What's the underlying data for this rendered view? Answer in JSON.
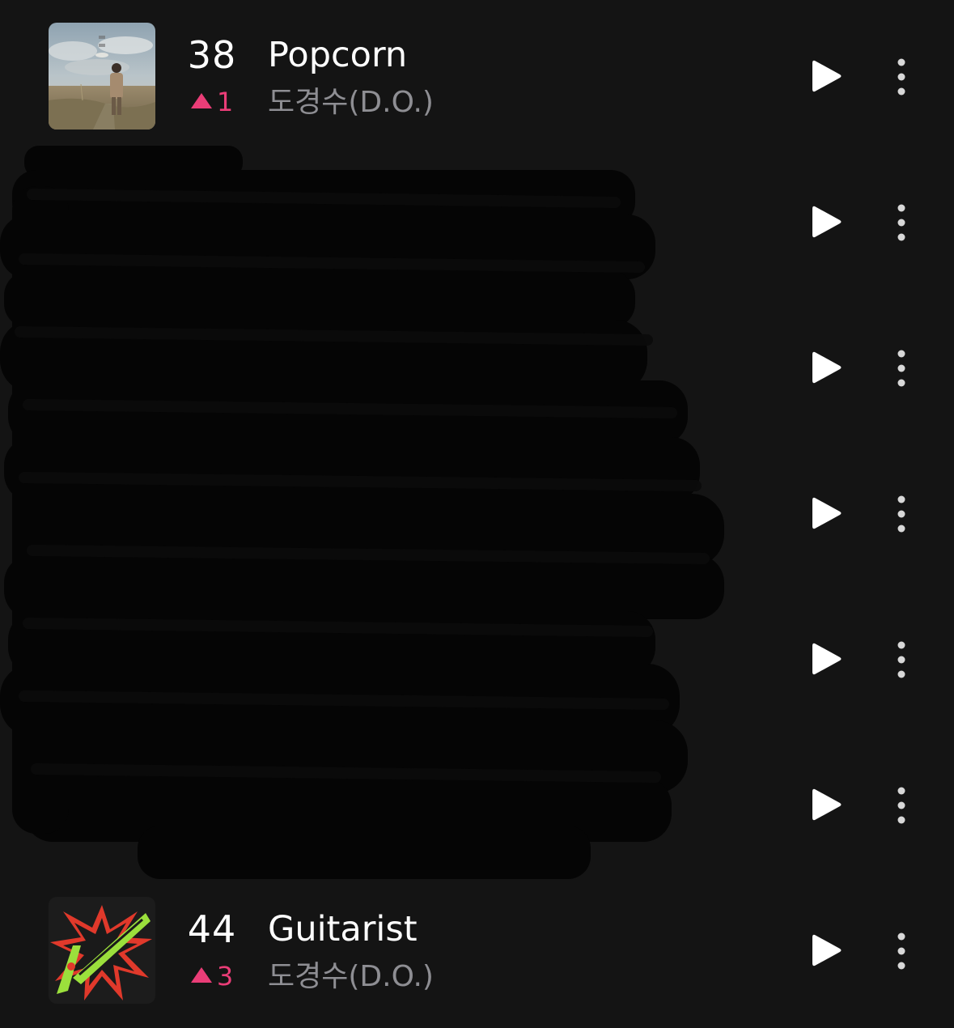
{
  "chart_list": {
    "rows": [
      {
        "rank": "38",
        "change": "1",
        "change_direction": "up",
        "title": "Popcorn",
        "artist": "도경수(D.O.)",
        "cover_icon": "album-cover-popcorn",
        "visible": true
      },
      {
        "rank": "",
        "title": "",
        "artist": "",
        "visible": false,
        "redacted": true
      },
      {
        "rank": "",
        "title": "",
        "artist": "",
        "visible": false,
        "redacted": true
      },
      {
        "rank": "",
        "title": "",
        "artist": "",
        "visible": false,
        "redacted": true
      },
      {
        "rank": "",
        "title": "",
        "artist": "",
        "visible": false,
        "redacted": true
      },
      {
        "rank": "",
        "title": "",
        "artist": "",
        "visible": false,
        "redacted": true
      },
      {
        "rank": "44",
        "change": "3",
        "change_direction": "up",
        "title": "Guitarist",
        "artist": "도경수(D.O.)",
        "cover_icon": "album-cover-guitarist",
        "visible": true
      }
    ],
    "row_icons": {
      "play": "play-icon",
      "more": "more-vertical-icon",
      "change_up": "triangle-up-icon"
    }
  },
  "colors": {
    "background": "#141414",
    "title": "#ffffff",
    "artist": "#8e8e93",
    "rank_up": "#ea3d77",
    "icon": "#ffffff",
    "redaction": "#050505"
  }
}
